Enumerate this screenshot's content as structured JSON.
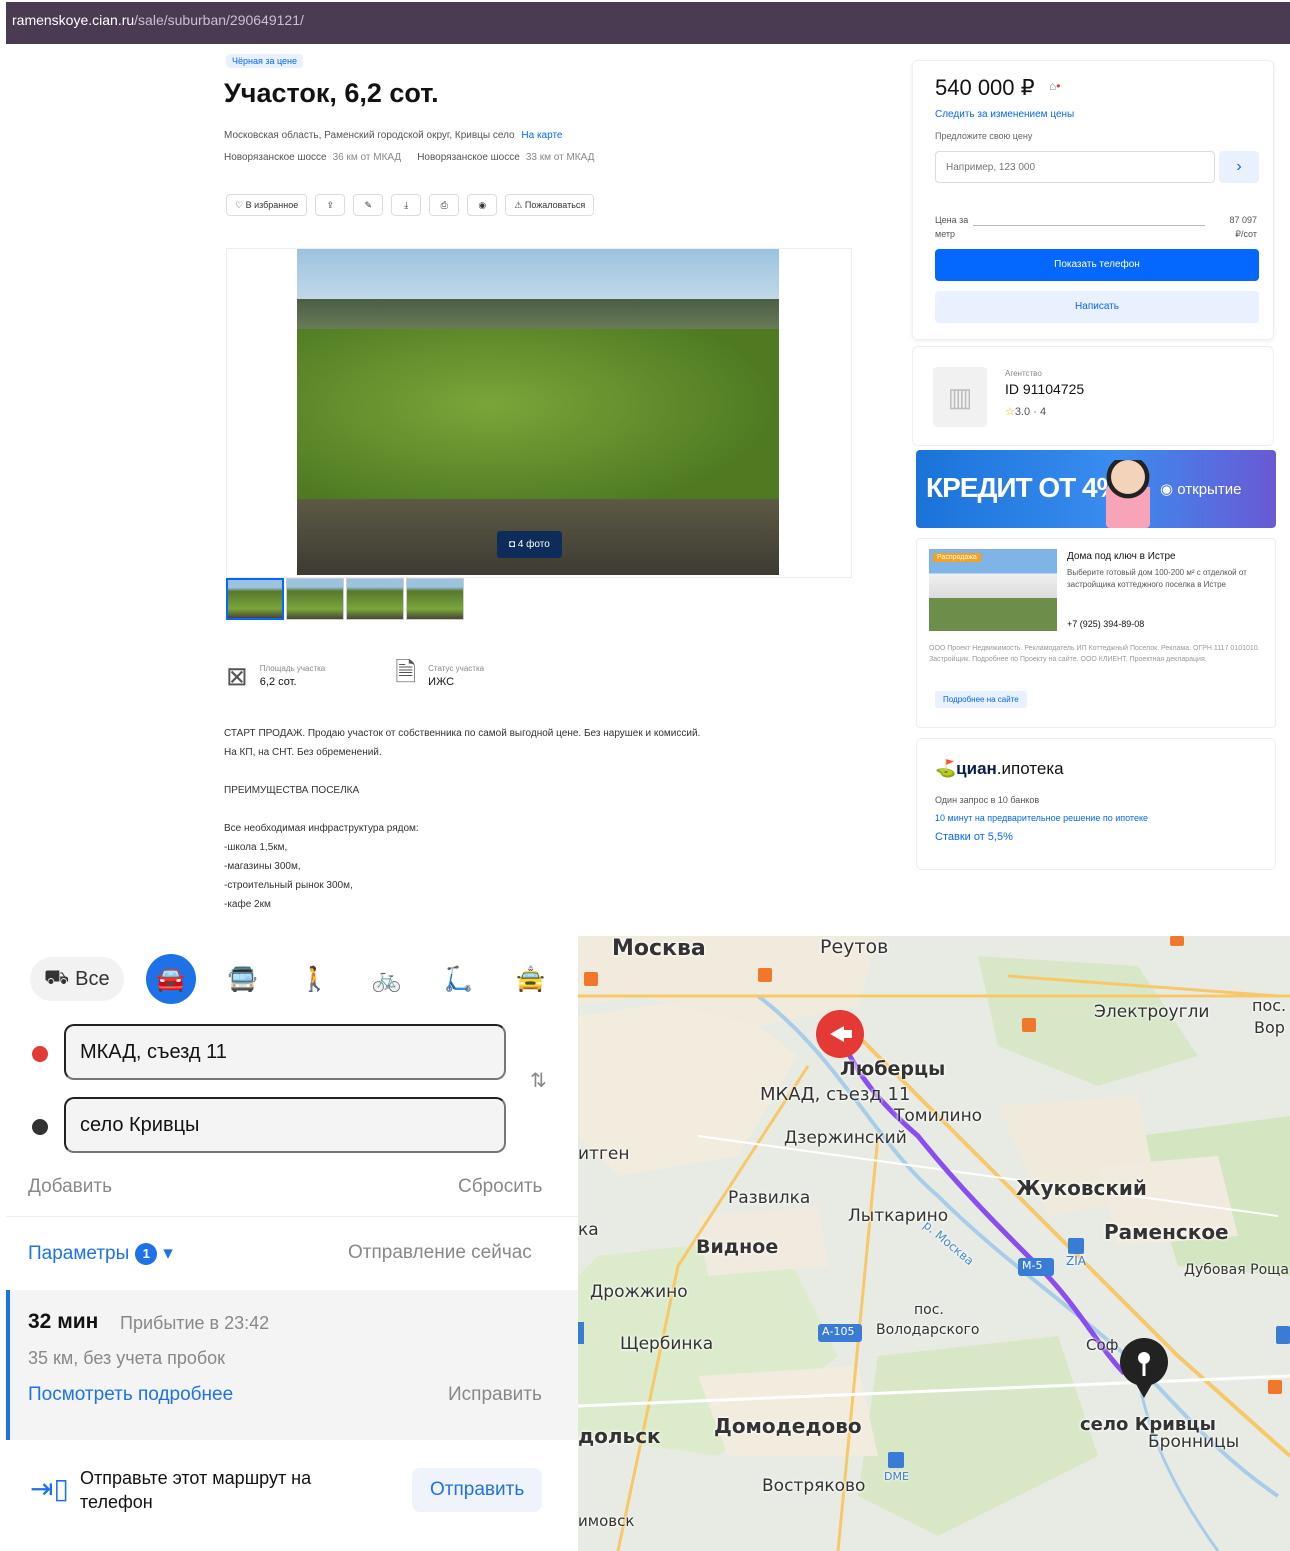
{
  "browser": {
    "url_host": "ramenskoye.cian.ru",
    "url_path": "/sale/suburban/290649121/"
  },
  "listing": {
    "badge": "Чёрная за цене",
    "title": "Участок, 6,2 сот.",
    "address": "Московская область, Раменский городской округ, Кривцы село",
    "address_link": "На карте",
    "highway_1": "Новорязанское шоссе",
    "highway_1_km": "36 км от МКАД",
    "highway_2": "Новорязанское шоссе",
    "highway_2_km": "33 км от МКАД",
    "toolbar": {
      "favorite": "В избранное",
      "complain": "Пожаловаться"
    },
    "photo_count": "4 фото",
    "params": [
      {
        "label": "Площадь участка",
        "value": "6,2 сот."
      },
      {
        "label": "Статус участка",
        "value": "ИЖС"
      }
    ],
    "description": [
      "СТАРТ ПРОДАЖ. Продаю участок от собственника по самой выгодной цене. Без нарушек и комиссий.",
      "На КП, на СНТ. Без обременений.",
      "",
      "ПРЕИМУЩЕСТВА ПОСЕЛКА",
      "",
      "Все необходимая инфраструктура рядом:",
      "-школа 1,5км,",
      "-магазины 300м,",
      "-строительный рынок 300м,",
      "-кафе 2км"
    ]
  },
  "price_card": {
    "price": "540 000 ₽",
    "price_icon": "⌂",
    "follow_link": "Следить за изменением цены",
    "offer_label": "Предложите свою цену",
    "offer_placeholder": "Например, 123 000",
    "row1_label": "Цена за",
    "row1_value": "87 097",
    "row2_label": "метр",
    "row2_value": "₽/сот",
    "show_phone": "Показать телефон",
    "write": "Написать"
  },
  "agent": {
    "role": "Агентство",
    "id": "ID 91104725",
    "rating": "3.0 · 4"
  },
  "bank_banner": {
    "text": "КРЕДИТ ОТ 4%",
    "brand": "открытие"
  },
  "ad": {
    "tag": "Распродажа",
    "title": "Дома под ключ в Истре",
    "text": "Выберите готовый дом 100-200 м² с отделкой от застройщика коттеджного поселка в Истре",
    "phone": "+7 (925) 394-89-08",
    "legal": "ООО Проект Недвижимость. Рекламодатель ИП Коттеджный Поселок. Реклама. ОГРН 1117 0101010. Застройщик. Подробнее по Проекту на сайте. ООО КЛИЕНТ. Проектная декларация.",
    "button": "Подробнее на сайте"
  },
  "ipoteka": {
    "brand": "циан",
    "product": ".ипотека",
    "sub": "Один запрос в 10 банков",
    "link": "10 минут на предварительное решение по ипотеке",
    "rate": "Ставки от 5,5%"
  },
  "route": {
    "mode_all": "Все",
    "from": "МКАД, съезд 11",
    "to": "село Кривцы",
    "add": "Добавить",
    "reset": "Сбросить",
    "params": "Параметры",
    "params_count": "1",
    "departure": "Отправление сейчас",
    "time": "32 мин",
    "arrival": "Прибытие в 23:42",
    "distance": "35 км, без учета пробок",
    "details": "Посмотреть подробнее",
    "fix": "Исправить",
    "send_text": "Отправьте этот маршрут на телефон",
    "send_button": "Отправить",
    "colors": {
      "accent": "#1e72e8",
      "route": "#8a4df0",
      "start": "#e53935"
    }
  },
  "map": {
    "labels": {
      "moscow": "Москва",
      "reutov": "Реутов",
      "elektrougli": "Электроугли",
      "pos": "пос.",
      "vor": "Вор",
      "lyubertsy": "Люберцы",
      "mkad_exit": "МКАД, съезд 11",
      "tomilino": "Томилино",
      "dzerzhinsky": "Дзержинский",
      "itgen": "итген",
      "razvilka": "Развилка",
      "zhukovsky": "Жуковский",
      "lytkarino": "Лыткарино",
      "ramenskoye": "Раменское",
      "vidnoe": "Видное",
      "dubovaya": "Дубовая Роща",
      "ka": "ка",
      "drozhzhino": "Дрожжино",
      "pos_volod": "пос.",
      "volod": "Володарского",
      "shcherbinka": "Щербинка",
      "sof": "Соф",
      "krivtsy": "село Кривцы",
      "bronnitsy": "Бронницы",
      "domodedovo": "Домодедово",
      "podolsk": "дольск",
      "vostryakovo": "Востряково",
      "dme": "DME",
      "chekhov": "имовск",
      "road_m5": "М-5",
      "road_a105": "А-105",
      "moskva_river": "р. Москва",
      "ramenskoye_2": "ZIA"
    }
  }
}
